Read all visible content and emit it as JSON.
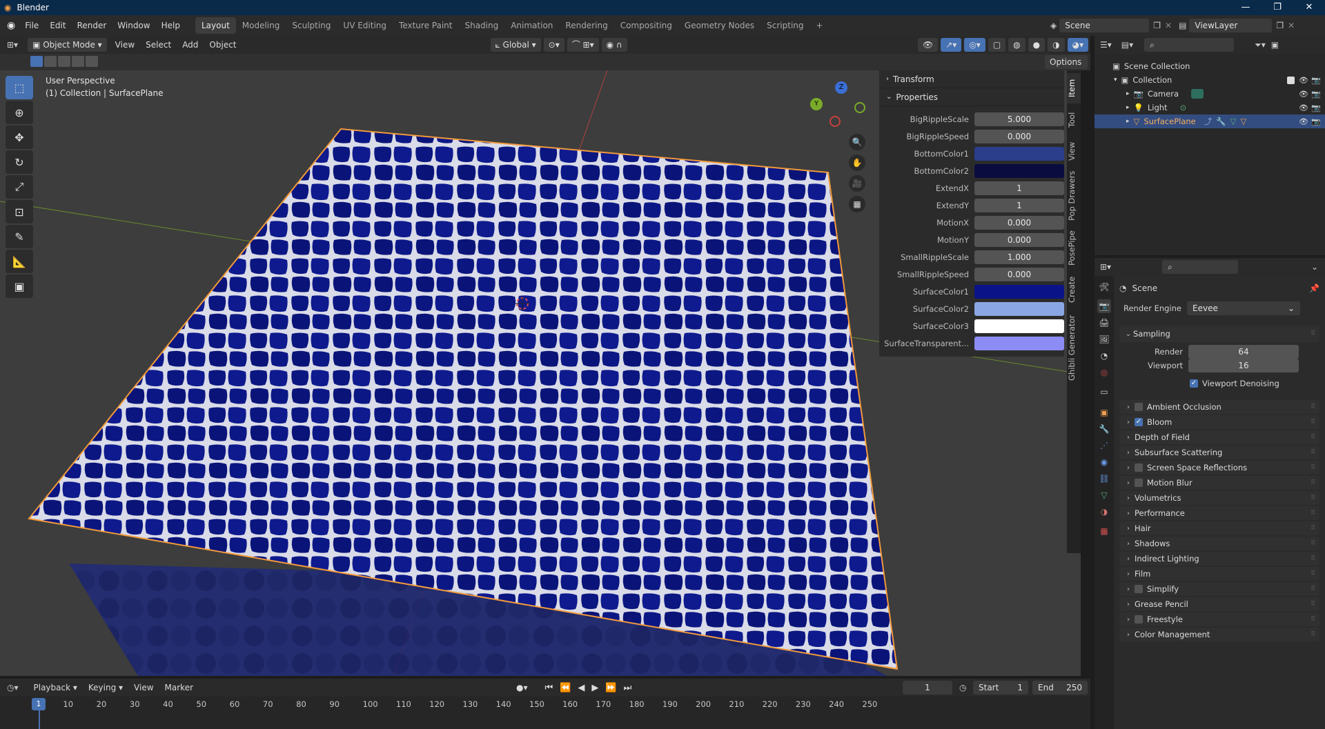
{
  "window": {
    "title": "Blender",
    "controls": [
      "—",
      "❐",
      "✕"
    ]
  },
  "menu": {
    "items": [
      "File",
      "Edit",
      "Render",
      "Window",
      "Help"
    ],
    "workspaces": [
      "Layout",
      "Modeling",
      "Sculpting",
      "UV Editing",
      "Texture Paint",
      "Shading",
      "Animation",
      "Rendering",
      "Compositing",
      "Geometry Nodes",
      "Scripting"
    ],
    "active_workspace": "Layout",
    "add_tab": "+",
    "scene": "Scene",
    "view_layer": "ViewLayer"
  },
  "viewport_header": {
    "mode": "Object Mode",
    "menus": [
      "View",
      "Select",
      "Add",
      "Object"
    ],
    "transform_orientation": "Global",
    "options": "Options"
  },
  "viewport": {
    "perspective": "User Perspective",
    "collection_line": "(1) Collection | SurfacePlane",
    "gizmo_axes": {
      "z": "Z",
      "y": "Y"
    }
  },
  "npanel": {
    "tabs": [
      "Item",
      "Tool",
      "View",
      "Pop Drawers",
      "PosePipe",
      "Create",
      "Ghibli Generator"
    ],
    "active_tab": "Item",
    "sections": {
      "transform": "Transform",
      "properties": "Properties"
    },
    "properties": [
      {
        "label": "BigRippleScale",
        "value": "5.000"
      },
      {
        "label": "BigRippleSpeed",
        "value": "0.000"
      },
      {
        "label": "BottomColor1",
        "value": "",
        "color": "#2a3e8c"
      },
      {
        "label": "BottomColor2",
        "value": "",
        "color": "#0a0c40"
      },
      {
        "label": "ExtendX",
        "value": "1"
      },
      {
        "label": "ExtendY",
        "value": "1"
      },
      {
        "label": "MotionX",
        "value": "0.000"
      },
      {
        "label": "MotionY",
        "value": "0.000"
      },
      {
        "label": "SmallRippleScale",
        "value": "1.000"
      },
      {
        "label": "SmallRippleSpeed",
        "value": "0.000"
      },
      {
        "label": "SurfaceColor1",
        "value": "",
        "color": "#0a1488"
      },
      {
        "label": "SurfaceColor2",
        "value": "",
        "color": "#8aa6e4"
      },
      {
        "label": "SurfaceColor3",
        "value": "",
        "color": "#ffffff"
      },
      {
        "label": "SurfaceTransparent...",
        "value": "",
        "color": "#8c8cf4"
      }
    ]
  },
  "timeline": {
    "menus": [
      "Playback",
      "Keying",
      "View",
      "Marker"
    ],
    "current_frame": "1",
    "start_label": "Start",
    "start": "1",
    "end_label": "End",
    "end": "250",
    "ticks": [
      "1",
      "10",
      "20",
      "30",
      "40",
      "50",
      "60",
      "70",
      "80",
      "90",
      "100",
      "110",
      "120",
      "130",
      "140",
      "150",
      "160",
      "170",
      "180",
      "190",
      "200",
      "210",
      "220",
      "230",
      "240",
      "250"
    ]
  },
  "outliner": {
    "root": "Scene Collection",
    "collection": "Collection",
    "items": [
      "Camera",
      "Light",
      "SurfacePlane"
    ],
    "selected": "SurfacePlane"
  },
  "properties_editor": {
    "context": "Scene",
    "render_engine_label": "Render Engine",
    "render_engine": "Eevee",
    "sampling": {
      "title": "Sampling",
      "render_label": "Render",
      "render": "64",
      "viewport_label": "Viewport",
      "viewport": "16",
      "denoise": "Viewport Denoising"
    },
    "panels": [
      {
        "label": "Ambient Occlusion",
        "checkbox": true,
        "checked": false
      },
      {
        "label": "Bloom",
        "checkbox": true,
        "checked": true
      },
      {
        "label": "Depth of Field",
        "checkbox": false
      },
      {
        "label": "Subsurface Scattering",
        "checkbox": false
      },
      {
        "label": "Screen Space Reflections",
        "checkbox": true,
        "checked": false
      },
      {
        "label": "Motion Blur",
        "checkbox": true,
        "checked": false
      },
      {
        "label": "Volumetrics",
        "checkbox": false
      },
      {
        "label": "Performance",
        "checkbox": false
      },
      {
        "label": "Hair",
        "checkbox": false
      },
      {
        "label": "Shadows",
        "checkbox": false
      },
      {
        "label": "Indirect Lighting",
        "checkbox": false
      },
      {
        "label": "Film",
        "checkbox": false
      },
      {
        "label": "Simplify",
        "checkbox": true,
        "checked": false
      },
      {
        "label": "Grease Pencil",
        "checkbox": false
      },
      {
        "label": "Freestyle",
        "checkbox": true,
        "checked": false
      },
      {
        "label": "Color Management",
        "checkbox": false
      }
    ]
  },
  "colors": {
    "accent": "#4772b3",
    "selected_row": "#334d80",
    "object_outline": "#f39a3a",
    "plane_blue": "#0b1680"
  }
}
